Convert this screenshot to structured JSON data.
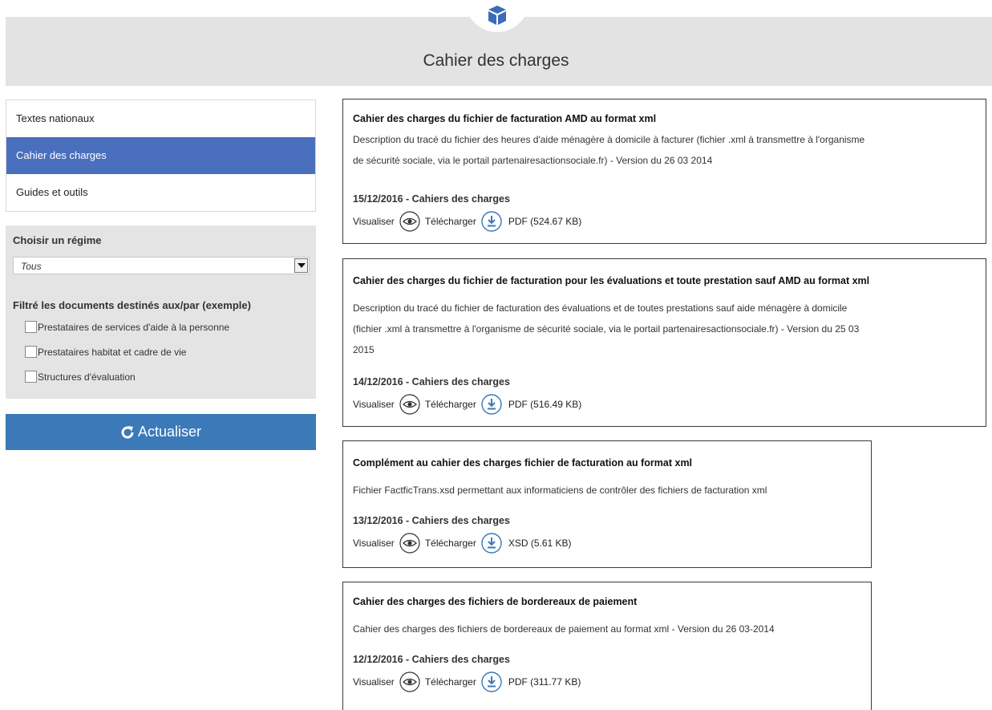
{
  "header": {
    "title": "Cahier des charges",
    "icon": "cube-icon"
  },
  "nav": {
    "items": [
      {
        "label": "Textes nationaux",
        "active": false
      },
      {
        "label": "Cahier des charges",
        "active": true
      },
      {
        "label": "Guides et outils",
        "active": false
      }
    ]
  },
  "filter": {
    "regime_title": "Choisir un régime",
    "regime_value": "Tous",
    "docs_title": "Filtré les documents destinés aux/par (exemple)",
    "options": [
      {
        "label": "Prestataires de services d'aide à la personne",
        "checked": false
      },
      {
        "label": "Prestataires habitat et cadre de vie",
        "checked": false
      },
      {
        "label": "Structures d'évaluation",
        "checked": false
      }
    ],
    "refresh_label": "Actualiser"
  },
  "documents": [
    {
      "title": "Cahier des charges du fichier de facturation AMD au format xml",
      "desc_lines": [
        "Description du tracé du fichier des heures d'aide ménagère à domicile à facturer (fichier .xml à transmettre à l'organisme",
        "de sécurité sociale, via le portail partenairesactionsociale.fr) - Version du 26 03 2014"
      ],
      "meta": "15/12/2016 - Cahiers des charges",
      "view_label": "Visualiser",
      "download_label": "Télécharger",
      "file": "PDF (524.67 KB)"
    },
    {
      "title": "Cahier des charges du fichier de facturation pour les évaluations et toute prestation sauf AMD au format xml",
      "desc_lines": [
        "Description du tracé du fichier de facturation des évaluations et de toutes prestations sauf aide ménagère à domicile",
        "(fichier .xml à transmettre à l'organisme de sécurité sociale, via le portail partenairesactionsociale.fr) - Version du 25 03",
        "2015"
      ],
      "meta": "14/12/2016 - Cahiers des charges",
      "view_label": "Visualiser",
      "download_label": "Télécharger",
      "file": "PDF (516.49 KB)"
    },
    {
      "title": "Complément au cahier des charges fichier de facturation au format xml",
      "desc_lines": [
        "Fichier FactficTrans.xsd permettant aux informaticiens de contrôler des fichiers de facturation xml"
      ],
      "meta": "13/12/2016 - Cahiers des charges",
      "view_label": "Visualiser",
      "download_label": "Télécharger",
      "file": "XSD (5.61 KB)"
    },
    {
      "title": "Cahier des charges des fichiers de bordereaux de paiement",
      "desc_lines": [
        "Cahier des charges des fichiers de bordereaux de paiement au format xml - Version du 26 03-2014"
      ],
      "meta": "12/12/2016 - Cahiers des charges",
      "view_label": "Visualiser",
      "download_label": "Télécharger",
      "file": "PDF (311.77 KB)"
    }
  ],
  "colors": {
    "accent": "#4a6fbd",
    "button": "#3b79b9",
    "banner": "#e3e3e3"
  }
}
